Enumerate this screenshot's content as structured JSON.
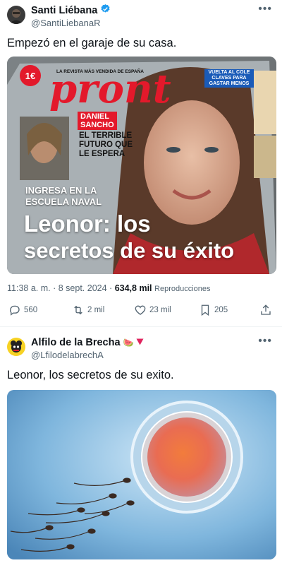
{
  "tweet1": {
    "author_name": "Santi Liébana",
    "author_handle": "@SantiLiebanaR",
    "text": "Empezó en el garaje de su casa.",
    "time": "11:38 a. m.",
    "separator": "·",
    "date": "8 sept. 2024",
    "views": "634,8 mil",
    "views_label": "Reproducciones",
    "replies": "560",
    "retweets": "2 mil",
    "likes": "23 mil",
    "bookmarks": "205",
    "verified_color": "#1d9bf0",
    "magazine": {
      "price": "1€",
      "tagline": "LA REVISTA MÁS VENDIDA DE ESPAÑA",
      "logo": "pront",
      "promo_line1": "VUELTA AL COLE",
      "promo_line2": "CLAVES PARA",
      "promo_line3": "GASTAR MENOS",
      "feature_name1": "DANIEL",
      "feature_name2": "SANCHO",
      "feature_line1": "EL TERRIBLE",
      "feature_line2": "FUTURO QUE",
      "feature_line3": "LE ESPERA",
      "kicker1": "INGRESA EN LA",
      "kicker2": "ESCUELA NAVAL",
      "headline1": "Leonor: los",
      "headline2": "secretos de su éxito"
    }
  },
  "tweet2": {
    "author_name": "Alfilo de la Brecha",
    "author_handle": "@LfilodelabrechA",
    "emoji": "🍉",
    "text": "Leonor, los secretos de su exito."
  },
  "more_label": "•••"
}
